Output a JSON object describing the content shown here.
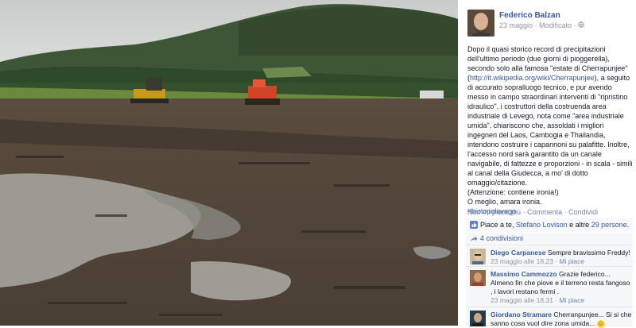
{
  "post": {
    "author": "Federico Balzan",
    "date": "23 maggio",
    "edited": "Modificato",
    "text_1": "Dopo il quasi storico record di precipitazioni dell'ultimo periodo (due giorni di pioggerella), secondo solo alla famosa \"estate di Cherrapunjee\" (",
    "link": "http://it.wikipedia.org/wiki/Cherrapunjee",
    "text_2": "), a seguito di accurato sopralluogo tecnico, e pur avendo messo in campo straordinari interventi di \"ripristino idraulico\", i costruttori della costruenda area industriale di Levego, nota come \"area industriale umida\", chiariscono che, assoldati i migliori ingegneri del Laos, Cambogia e Thailandia, intendono costruire i capannoni su palafitte. Inoltre, l'accesso nord sarà garantito da un canale navigabile, di fattezze e proporzioni - in scala - simili al canal della Giudecca, a mo' di dotto omaggio/citazione.",
    "text_3": "(Attenzione: contiene ironia!)",
    "text_4": "O meglio, amara ironia.",
    "hashtag": "#biotopolevego"
  },
  "actions": {
    "unlike": "Non mi piace più",
    "comment": "Commenta",
    "share": "Condividi",
    "sep": "·"
  },
  "likes": {
    "prefix": "Piace a te, ",
    "person": "Stefano Lovison",
    "middle": " e altre ",
    "others": "29 persone",
    "suffix": "."
  },
  "shares": {
    "label": "4 condivisioni"
  },
  "comments": [
    {
      "name": "Diego Carpanese",
      "text": "Sempre bravissimo Freddy!",
      "time": "23 maggio alle 18.23",
      "like": "Mi piace"
    },
    {
      "name": "Massimo Cammozzo",
      "text": "Grazie federico... Almeno fin che piove e il terreno resta fangoso , i lavori restano fermi .",
      "time": "23 maggio alle 18.31",
      "like": "Mi piace"
    },
    {
      "name": "Giordano Stramare",
      "text": "Cherranpunjee... Si si che sanno cosa vuol dire zona umida...",
      "emoji": "☺"
    }
  ],
  "colors": {
    "link": "#3b5998",
    "muted": "#90949c",
    "panel_bg": "#f6f7f9"
  }
}
